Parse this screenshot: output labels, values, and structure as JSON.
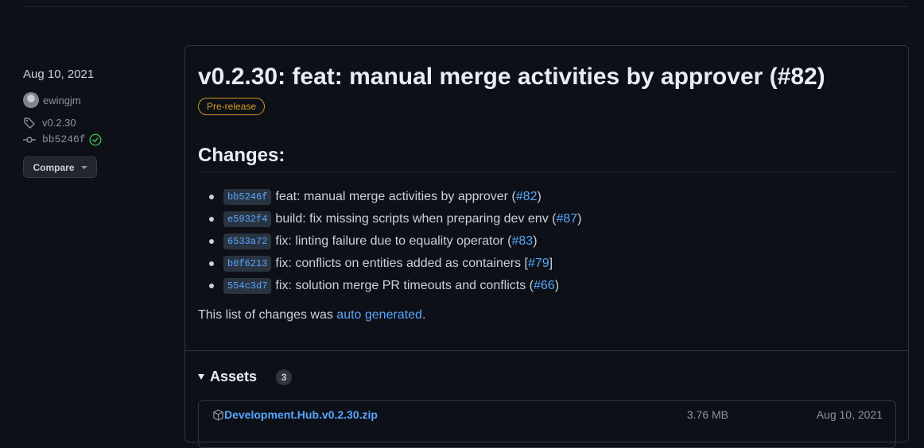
{
  "meta": {
    "date": "Aug 10, 2021",
    "author": "ewingjm",
    "tag": "v0.2.30",
    "commit": "bb5246f",
    "compare_label": "Compare"
  },
  "release": {
    "title": "v0.2.30: feat: manual merge activities by approver (#82)",
    "badge": "Pre-release",
    "changes_heading": "Changes:",
    "changes": [
      {
        "sha": "bb5246f",
        "text": "feat: manual merge activities by approver (",
        "ref": "#82",
        "end": ")"
      },
      {
        "sha": "e5932f4",
        "text": "build: fix missing scripts when preparing dev env (",
        "ref": "#87",
        "end": ")"
      },
      {
        "sha": "6533a72",
        "text": "fix: linting failure due to equality operator (",
        "ref": "#83",
        "end": ")"
      },
      {
        "sha": "b0f6213",
        "text": "fix: conflicts on entities added as containers [ ",
        "ref": "#79",
        "end": " ]"
      },
      {
        "sha": "554c3d7",
        "text": "fix: solution merge PR timeouts and conflicts (",
        "ref": "#66",
        "end": ")"
      }
    ],
    "footnote_prefix": "This list of changes was ",
    "footnote_link": "auto generated",
    "footnote_suffix": "."
  },
  "assets": {
    "heading": "Assets",
    "count": "3",
    "items": [
      {
        "name": "Development.Hub.v0.2.30.zip",
        "size": "3.76 MB",
        "date": "Aug 10, 2021"
      }
    ]
  },
  "colors": {
    "background": "#0d1117",
    "link": "#58a6ff",
    "prerelease": "#d29922",
    "verified": "#3fb950"
  }
}
